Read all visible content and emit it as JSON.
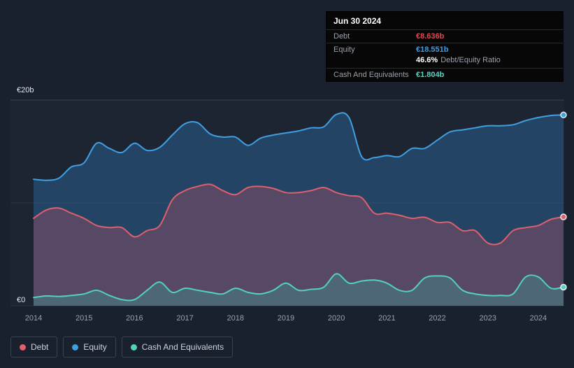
{
  "tooltip": {
    "date": "Jun 30 2024",
    "debt_label": "Debt",
    "debt_value": "€8.636b",
    "equity_label": "Equity",
    "equity_value": "€18.551b",
    "ratio_value": "46.6%",
    "ratio_label": "Debt/Equity Ratio",
    "cash_label": "Cash And Equivalents",
    "cash_value": "€1.804b"
  },
  "axis": {
    "y_top_label": "€20b",
    "y_zero_label": "€0",
    "x_ticks": [
      "2014",
      "2015",
      "2016",
      "2017",
      "2018",
      "2019",
      "2020",
      "2021",
      "2022",
      "2023",
      "2024"
    ]
  },
  "legend": {
    "items": [
      {
        "label": "Debt",
        "color": "#df5f6d"
      },
      {
        "label": "Equity",
        "color": "#3f9fe0"
      },
      {
        "label": "Cash And Equivalents",
        "color": "#53d1be"
      }
    ]
  },
  "colors": {
    "background": "#1a212e",
    "plot_background": "#222b3a",
    "grid": "#39414f",
    "grid_faint": "#2a3240",
    "debt_value": "#e0484f",
    "equity_value": "#3ca1e6",
    "cash_value": "#56d6c4"
  },
  "chart_data": {
    "type": "area",
    "title": "",
    "xlabel": "",
    "ylabel": "",
    "ylim": [
      0,
      20
    ],
    "y_unit": "€ billions",
    "gridlines": [
      0,
      10,
      20
    ],
    "legend_position": "bottom",
    "draw_order": [
      "Equity",
      "Debt",
      "Cash And Equivalents"
    ],
    "x": [
      2014,
      2014.25,
      2014.5,
      2014.75,
      2015,
      2015.25,
      2015.5,
      2015.75,
      2016,
      2016.25,
      2016.5,
      2016.75,
      2017,
      2017.25,
      2017.5,
      2017.75,
      2018,
      2018.25,
      2018.5,
      2018.75,
      2019,
      2019.25,
      2019.5,
      2019.75,
      2020,
      2020.25,
      2020.5,
      2020.75,
      2021,
      2021.25,
      2021.5,
      2021.75,
      2022,
      2022.25,
      2022.5,
      2022.75,
      2023,
      2023.25,
      2023.5,
      2023.75,
      2024,
      2024.25,
      2024.5
    ],
    "series": [
      {
        "name": "Debt",
        "color": "#df5f6d",
        "fill": "rgba(196,80,100,0.32)",
        "values": [
          8.5,
          9.3,
          9.5,
          9.0,
          8.5,
          7.8,
          7.6,
          7.6,
          6.7,
          7.3,
          7.8,
          10.3,
          11.2,
          11.6,
          11.8,
          11.2,
          10.8,
          11.5,
          11.6,
          11.4,
          11.0,
          11.0,
          11.2,
          11.5,
          11.0,
          10.7,
          10.5,
          9.0,
          9.0,
          8.8,
          8.5,
          8.6,
          8.1,
          8.1,
          7.3,
          7.3,
          6.1,
          6.1,
          7.3,
          7.6,
          7.8,
          8.4,
          8.636
        ]
      },
      {
        "name": "Equity",
        "color": "#3f9fe0",
        "fill": "rgba(47,111,173,0.42)",
        "values": [
          12.3,
          12.2,
          12.4,
          13.5,
          13.9,
          15.8,
          15.3,
          14.9,
          15.8,
          15.1,
          15.4,
          16.6,
          17.7,
          17.8,
          16.7,
          16.4,
          16.4,
          15.6,
          16.3,
          16.6,
          16.8,
          17.0,
          17.3,
          17.4,
          18.6,
          18.3,
          14.5,
          14.4,
          14.6,
          14.5,
          15.3,
          15.3,
          16.1,
          16.9,
          17.1,
          17.3,
          17.5,
          17.5,
          17.6,
          18.0,
          18.3,
          18.5,
          18.551
        ]
      },
      {
        "name": "Cash And Equivalents",
        "color": "#53d1be",
        "fill": "rgba(60,177,163,0.30)",
        "values": [
          0.8,
          0.95,
          0.9,
          1.0,
          1.15,
          1.5,
          1.0,
          0.6,
          0.6,
          1.5,
          2.3,
          1.3,
          1.7,
          1.5,
          1.3,
          1.15,
          1.7,
          1.3,
          1.15,
          1.5,
          2.2,
          1.5,
          1.6,
          1.8,
          3.1,
          2.2,
          2.4,
          2.5,
          2.2,
          1.5,
          1.5,
          2.7,
          2.9,
          2.7,
          1.5,
          1.15,
          1.0,
          1.0,
          1.15,
          2.8,
          2.8,
          1.7,
          1.804
        ]
      }
    ]
  }
}
